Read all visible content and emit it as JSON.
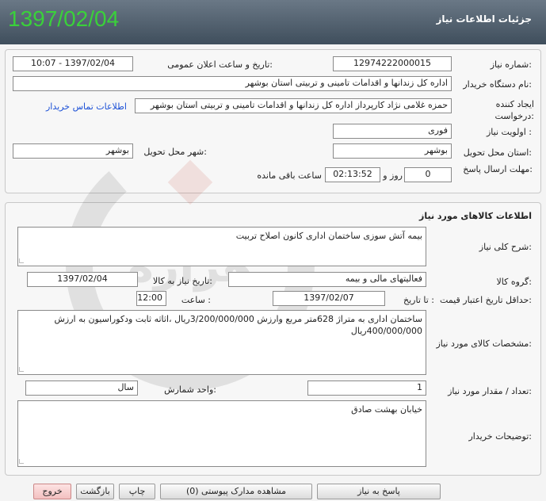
{
  "header": {
    "title": "جزئیات اطلاعات نیاز",
    "date": "1397/02/04"
  },
  "info": {
    "need_number_label": "شماره نیاز:",
    "need_number": "12974222000015",
    "announce_label": "تاریخ و ساعت اعلان عمومی:",
    "announce_value": "1397/02/04 - 10:07",
    "buyer_org_label": "نام دستگاه خریدار:",
    "buyer_org": "اداره کل زندانها و اقدامات تامینی و تربیتی استان بوشهر",
    "creator_label": "ایجاد کننده درخواست:",
    "creator": "حمزه غلامی نژاد کارپرداز اداره کل زندانها و اقدامات تامینی و تربیتی استان بوشهر",
    "contact_link": "اطلاعات تماس خریدار",
    "priority_label": "اولویت نیاز :",
    "priority": "فوری",
    "province_label": "استان محل تحویل:",
    "province": "بوشهر",
    "city_label": "شهر محل تحویل:",
    "city": "بوشهر",
    "deadline_label": "مهلت ارسال پاسخ:",
    "days": "0",
    "days_word": "روز و",
    "time": "02:13:52",
    "remaining": "ساعت باقی مانده"
  },
  "goods": {
    "section_title": "اطلاعات کالاهای مورد نیاز",
    "general_desc_label": "شرح کلی نیاز:",
    "general_desc": "بیمه آتش سوزی ساختمان اداری کانون اصلاح تربیت",
    "group_label": "گروه کالا:",
    "group": "فعالیتهای مالی و بیمه",
    "need_date_label": "تاریخ نیاز به کالا:",
    "need_date": "1397/02/04",
    "validity_label": "حداقل تاریخ اعتبار قیمت:",
    "until_label": "تا تاریخ :",
    "validity_date": "1397/02/07",
    "hour_label": "ساعت :",
    "validity_time": "12:00",
    "spec_label": "مشخصات کالای مورد نیاز:",
    "spec": "ساختمان اداری به متراژ 628متر مربع وارزش 3/200/000/000ریال ،اثاثه ثابت ودکوراسیون به ارزش 400/000/000ریال",
    "qty_label": "تعداد / مقدار مورد نیاز:",
    "qty": "1",
    "unit_label": "واحد شمارش:",
    "unit": "سال",
    "buyer_notes_label": "توضیحات خریدار:",
    "buyer_notes": "خیابان بهشت صادق"
  },
  "buttons": {
    "reply": "پاسخ به نیاز",
    "attachments": "مشاهده مدارک پیوستی (0)",
    "print": "چاپ",
    "back": "بازگشت",
    "exit": "خروج"
  },
  "watermark": {
    "text": "هزاره",
    "color": "#c0392b"
  }
}
